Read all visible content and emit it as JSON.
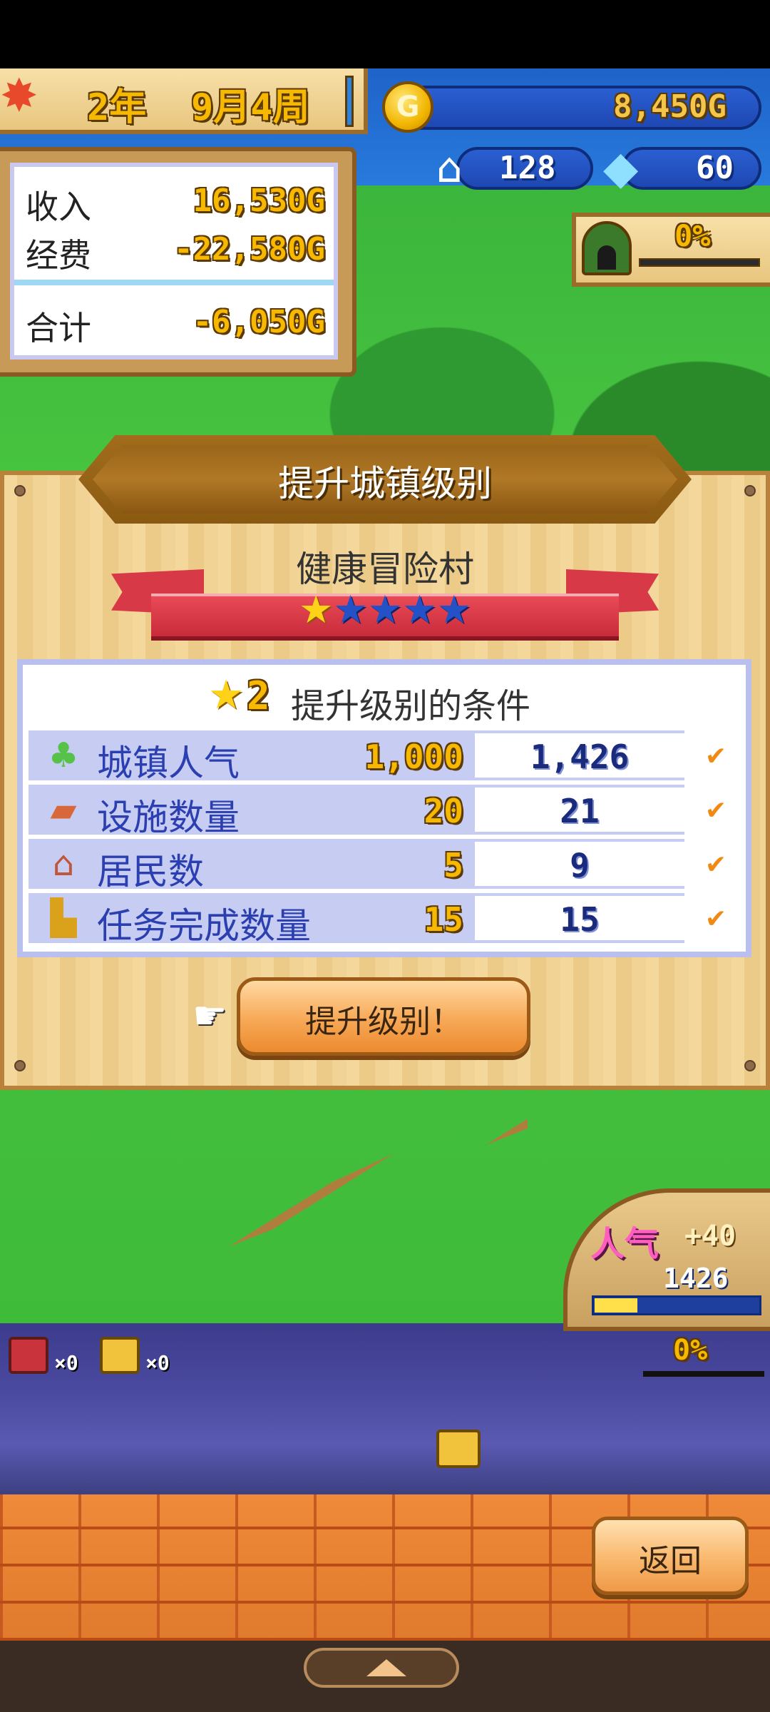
{
  "hud": {
    "year": "2年",
    "month_week": "9月4周",
    "gold": "8,450G",
    "residents": "128",
    "gems": "60",
    "cave_percent": "0%"
  },
  "finance": {
    "income_label": "收入",
    "income_value": "16,530G",
    "expense_label": "经费",
    "expense_value": "-22,580G",
    "total_label": "合计",
    "total_value": "-6,050G"
  },
  "dialog": {
    "title": "提升城镇级别",
    "town_name": "健康冒险村",
    "stars_filled": 1,
    "stars_total": 5,
    "conditions_level": "2",
    "conditions_title": "提升级别的条件",
    "rows": [
      {
        "label": "城镇人气",
        "required": "1,000",
        "current": "1,426",
        "icon": "popularity-icon"
      },
      {
        "label": "设施数量",
        "required": "20",
        "current": "21",
        "icon": "facility-icon"
      },
      {
        "label": "居民数",
        "required": "5",
        "current": "9",
        "icon": "house-icon"
      },
      {
        "label": "任务完成数量",
        "required": "15",
        "current": "15",
        "icon": "quest-icon"
      }
    ],
    "check_mark": "✔",
    "levelup_label": "提升级别！"
  },
  "gauge": {
    "label": "人气",
    "bonus": "+40",
    "value": "1426"
  },
  "chests": {
    "red_count": "×0",
    "gold_count": "×0"
  },
  "forest_percent": "0%",
  "back_label": "返回",
  "colors": {
    "accent_gold": "#f6b800",
    "panel_blue": "#1e48b3",
    "ribbon_red": "#d73a46",
    "check_orange": "#f08a12"
  }
}
